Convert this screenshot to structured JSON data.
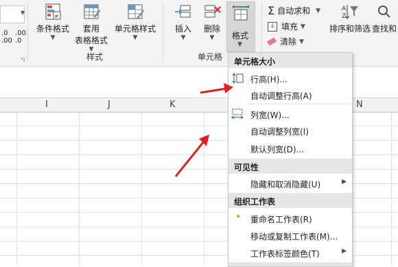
{
  "ribbon": {
    "left_partial_labels": [
      ".0",
      ".00",
      ".00",
      ".0"
    ],
    "cond_format": "条件格式",
    "table_format_line1": "套用",
    "table_format_line2": "表格格式",
    "cell_style": "单元格样式",
    "style_group": "样式",
    "insert": "插入",
    "delete": "删除",
    "format": "格式",
    "cells_group": "单元格",
    "autosum": "自动求和",
    "fill": "填充",
    "clear": "清除",
    "sort_filter": "排序和筛选",
    "find_select": "查找和"
  },
  "columns": [
    "I",
    "J",
    "K",
    "N"
  ],
  "menu": {
    "section_cell_size": "单元格大小",
    "row_height": "行高(H)...",
    "autofit_row_height": "自动调整行高(A)",
    "column_width": "列宽(W)...",
    "autofit_column_width": "自动调整列宽(I)",
    "default_width": "默认列宽(D)...",
    "section_visibility": "可见性",
    "hide_unhide": "隐藏和取消隐藏(U)",
    "section_organize": "组织工作表",
    "rename_sheet": "重命名工作表(R)",
    "move_copy_sheet": "移动或复制工作表(M)...",
    "tab_color": "工作表标签颜色(T)"
  },
  "colors": {
    "accent": "#217346",
    "arrow": "#e02020",
    "bullet": "#f39c12"
  }
}
